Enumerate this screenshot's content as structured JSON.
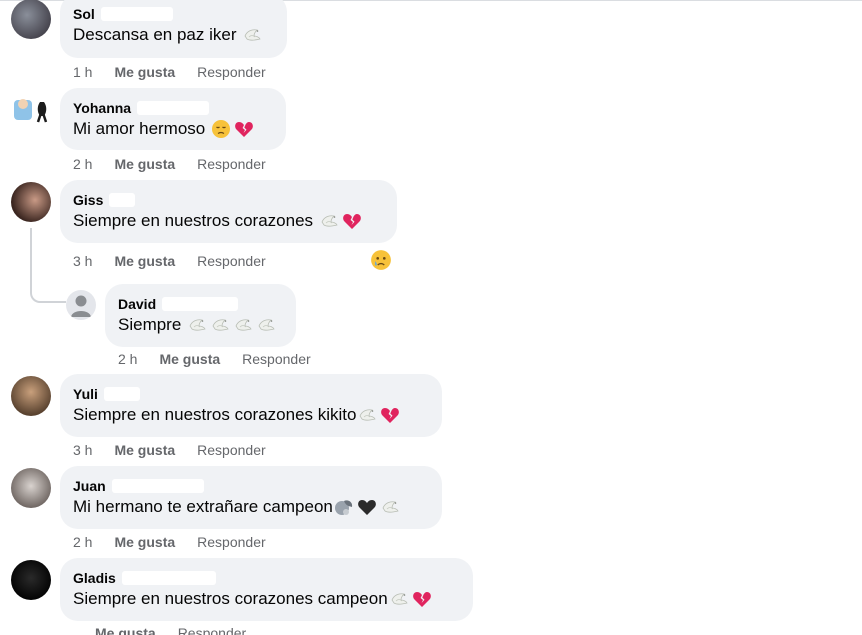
{
  "comments": [
    {
      "name": "Sol",
      "text": "Descansa en paz iker",
      "emojis": [
        "dove-icon"
      ],
      "time": "1 h"
    },
    {
      "name": "Yohanna",
      "text": "Mi amor hermoso",
      "emojis": [
        "sad-face-icon",
        "broken-heart-icon"
      ],
      "time": "2 h"
    },
    {
      "name": "Giss",
      "text": "Siempre en nuestros corazones",
      "emojis": [
        "dove-icon",
        "broken-heart-icon"
      ],
      "time": "3 h",
      "reaction": "crying-face-icon"
    },
    {
      "name": "David",
      "text": "Siempre",
      "emojis": [
        "dove-icon",
        "dove-icon",
        "dove-icon",
        "dove-icon"
      ],
      "time": "2 h"
    },
    {
      "name": "Yuli",
      "text": "Siempre en nuestros corazones kikito",
      "emojis": [
        "dove-icon",
        "broken-heart-icon"
      ],
      "time": "3 h"
    },
    {
      "name": "Juan",
      "text": "Mi hermano te extrañare campeon",
      "emojis": [
        "weary-face-icon",
        "black-heart-icon",
        "dove-icon"
      ],
      "time": "2 h"
    },
    {
      "name": "Gladis",
      "text": "Siempre en nuestros corazones campeon",
      "emojis": [
        "dove-icon",
        "broken-heart-icon"
      ],
      "time": ""
    }
  ],
  "actions": {
    "like_label": "Me gusta",
    "reply_label": "Responder"
  },
  "colors": {
    "bubble": "#f0f2f5",
    "secondary_text": "#65676b",
    "broken_heart": "#e0245e"
  }
}
